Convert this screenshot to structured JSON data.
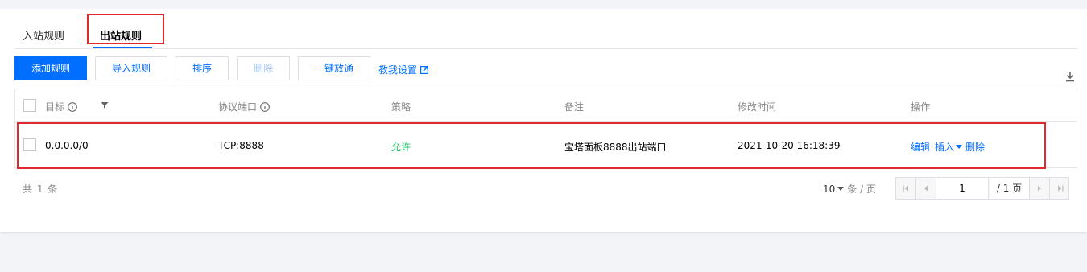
{
  "tabs": [
    {
      "label": "入站规则"
    },
    {
      "label": "出站规则"
    }
  ],
  "toolbar": {
    "add_label": "添加规则",
    "import_label": "导入规则",
    "sort_label": "排序",
    "delete_label": "删除",
    "allow_all_label": "一键放通",
    "tutorial_label": "教我设置"
  },
  "table": {
    "columns": [
      "目标",
      "协议端口",
      "策略",
      "备注",
      "修改时间",
      "操作"
    ],
    "rows": [
      {
        "target": "0.0.0.0/0",
        "port": "TCP:8888",
        "policy": "允许",
        "remark": "宝塔面板8888出站端口",
        "modified": "2021-10-20 16:18:39",
        "actions": [
          "编辑",
          "插入",
          "删除"
        ]
      }
    ]
  },
  "footer": {
    "total": "共 1 条",
    "page_size": "10",
    "page_size_unit": "条 / 页",
    "current_page": "1",
    "total_pages": "/ 1 页"
  },
  "colors": {
    "accent": "#006eff",
    "allow": "#0abf5b",
    "highlight": "#e0282e"
  }
}
